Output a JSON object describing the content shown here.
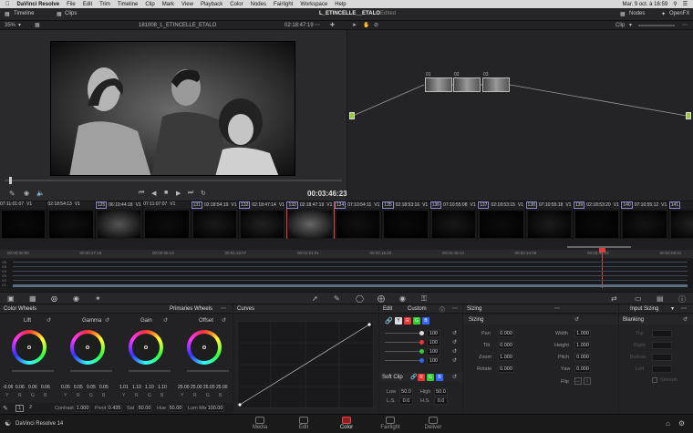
{
  "menubar": {
    "apple": "",
    "app_name": "DaVinci Resolve",
    "items": [
      "File",
      "Edit",
      "Trim",
      "Timeline",
      "Clip",
      "Mark",
      "View",
      "Playback",
      "Color",
      "Nodes",
      "Fairlight",
      "Workspace",
      "Help"
    ],
    "clock": "Mar. 9 oct. à 16:59"
  },
  "titlebar": {
    "timeline_label": "Timeline",
    "clips_label": "Clips",
    "project_title": "L_ETINCELLE__ETALO",
    "status": "Edited",
    "nodes_label": "Nodes",
    "openfx_label": "OpenFX"
  },
  "viewer": {
    "zoom": "35%",
    "clip_name": "181008_L_ETINCELLE_ETALO",
    "timecode_top": "02:18:47:19",
    "timecode": "00:03:46:23"
  },
  "nodes_panel": {
    "clip_label": "Clip",
    "nodes": [
      {
        "label": "01"
      },
      {
        "label": "02"
      },
      {
        "label": "03"
      }
    ]
  },
  "clips": [
    {
      "num": "",
      "tc": "07:11:01:07",
      "track": "V1"
    },
    {
      "num": "",
      "tc": "02:18:54:13",
      "track": "V1"
    },
    {
      "num": "125",
      "tc": "06:19:44:18",
      "track": "V1"
    },
    {
      "num": "",
      "tc": "07:11:07:07",
      "track": "V1"
    },
    {
      "num": "131",
      "tc": "02:18:54:19",
      "track": "V1"
    },
    {
      "num": "132",
      "tc": "02:18:47:14",
      "track": "V1"
    },
    {
      "num": "133",
      "tc": "02:18:47:19",
      "track": "V1"
    },
    {
      "num": "134",
      "tc": "07:10:54:11",
      "track": "V1"
    },
    {
      "num": "135",
      "tc": "02:18:53:16",
      "track": "V1"
    },
    {
      "num": "136",
      "tc": "07:10:55:08",
      "track": "V1"
    },
    {
      "num": "137",
      "tc": "02:18:53:15",
      "track": "V1"
    },
    {
      "num": "138",
      "tc": "07:10:55:18",
      "track": "V1"
    },
    {
      "num": "139",
      "tc": "02:18:53:20",
      "track": "V1"
    },
    {
      "num": "140",
      "tc": "07:10:55:12",
      "track": "V1"
    },
    {
      "num": "141",
      "tc": "",
      "track": ""
    }
  ],
  "mini_timeline": {
    "ruler": [
      "00:00:00:00",
      "00:00:27:19",
      "00:00:55:13",
      "00:01:23:07",
      "00:01:51:01",
      "00:02:18:20",
      "00:02:46:14",
      "00:03:14:08",
      "00:03:42:02",
      "00:04:09:21"
    ],
    "tracks": [
      "V6",
      "V5",
      "V4",
      "V3",
      "V2",
      "V1"
    ]
  },
  "color_wheels": {
    "title": "Color Wheels",
    "mode": "Primaries Wheels",
    "wheels": [
      {
        "name": "Lift",
        "values": [
          "-0.06",
          "0.06",
          "0.06",
          "0.06"
        ]
      },
      {
        "name": "Gamma",
        "values": [
          "0.05",
          "0.05",
          "0.05",
          "0.05"
        ]
      },
      {
        "name": "Gain",
        "values": [
          "1.01",
          "1.10",
          "1.10",
          "1.10"
        ]
      },
      {
        "name": "Offset",
        "values": [
          "25.00",
          "25.00",
          "25.00",
          "25.00"
        ]
      }
    ],
    "channels": [
      "Y",
      "R",
      "G",
      "B"
    ],
    "page_btns": [
      "1",
      "2"
    ],
    "contrast_label": "Contrast",
    "contrast": "1.000",
    "pivot_label": "Pivot",
    "pivot": "0.435",
    "sat_label": "Sat",
    "sat": "50.00",
    "hue_label": "Hue",
    "hue": "50.00",
    "lummix_label": "Lum Mix",
    "lummix": "100.00"
  },
  "curves": {
    "title": "Curves",
    "mode": "Custom"
  },
  "edit": {
    "title": "Edit",
    "channel_values": [
      "100",
      "100",
      "100",
      "100"
    ],
    "soft_clip_title": "Soft Clip",
    "low_label": "Low",
    "low": "50.0",
    "high_label": "High",
    "high": "50.0",
    "ls_label": "L.S.",
    "ls": "0.0",
    "hs_label": "H.S.",
    "hs": "0.0"
  },
  "sizing": {
    "title": "Sizing",
    "subtitle": "Sizing",
    "pan_label": "Pan",
    "pan": "0.000",
    "tilt_label": "Tilt",
    "tilt": "0.000",
    "zoom_label": "Zoom",
    "zoom": "1.000",
    "rotate_label": "Rotate",
    "rotate": "0.000",
    "width_label": "Width",
    "width": "1.000",
    "height_label": "Height",
    "height": "1.000",
    "pitch_label": "Pitch",
    "pitch": "0.000",
    "yaw_label": "Yaw",
    "yaw": "0.000",
    "flip_label": "Flip"
  },
  "input_sizing": {
    "title": "Input Sizing",
    "blanking_label": "Blanking",
    "fields": [
      "Top",
      "Right",
      "Bottom",
      "Left"
    ],
    "smooth_label": "Smooth"
  },
  "footer": {
    "app_label": "DaVinci Resolve 14",
    "tabs": [
      "Media",
      "Edit",
      "Color",
      "Fairlight",
      "Deliver"
    ],
    "active_tab": "Color"
  },
  "colors": {
    "accent_red": "#e43c3c",
    "playhead": "#e43c3c",
    "node_link": "#999999",
    "ch_red": "#e33",
    "ch_green": "#3c3",
    "ch_blue": "#36f"
  }
}
